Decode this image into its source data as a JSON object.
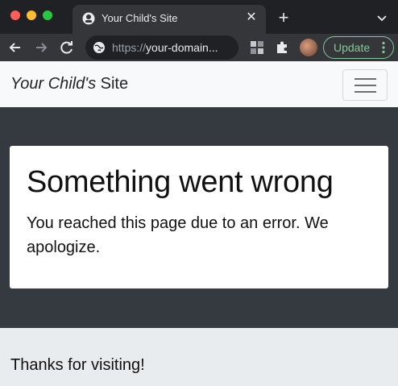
{
  "browser": {
    "tab_title": "Your Child's Site",
    "tab_close": "✕",
    "new_tab": "+",
    "url_scheme": "https://",
    "url_host": "your-domain...",
    "update_label": "Update",
    "icons": [
      "tab-favicon-icon",
      "back-arrow-icon",
      "forward-arrow-icon",
      "reload-icon",
      "site-info-icon",
      "extension-grid-icon",
      "puzzle-icon",
      "profile-avatar",
      "more-vert-icon",
      "tab-search-icon"
    ],
    "accent": "#81c995"
  },
  "navbar": {
    "brand_italic": "Your Child's",
    "brand_rest": " Site"
  },
  "card": {
    "title": "Something went wrong",
    "text": "You reached this page due to an error. We apologize."
  },
  "footer": {
    "text": "Thanks for visiting!"
  },
  "colors": {
    "dark_bg": "#343a40",
    "footer_bg": "#e9ecef",
    "navbar_bg": "#f8f9fa"
  }
}
